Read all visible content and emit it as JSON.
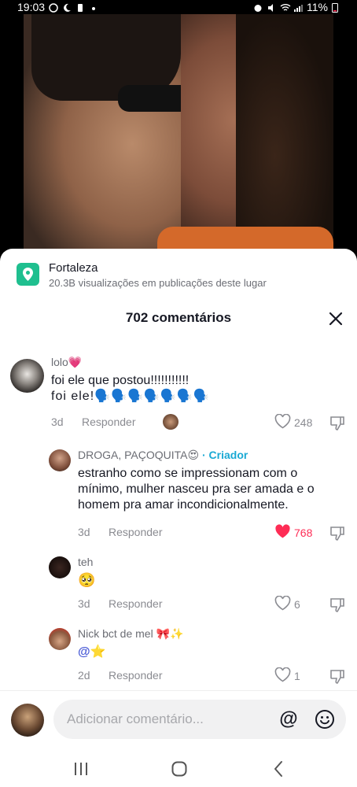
{
  "status": {
    "time": "19:03",
    "battery": "11%"
  },
  "location": {
    "title": "Fortaleza",
    "subtitle": "20.3B visualizações em publicações deste lugar"
  },
  "comments_header": "702 comentários",
  "comments": [
    {
      "username": "lolo",
      "username_emoji": "💗",
      "text_line1": "foi ele que postou!!!!!!!!!!!",
      "text_line2": "foi ele!🗣️🗣️🗣️🗣️🗣️🗣️🗣️",
      "age": "3d",
      "reply": "Responder",
      "likes": "248",
      "liked": false
    },
    {
      "username": "DROGA, PAÇOQUITA",
      "username_emoji": "😍",
      "creator_tag": "· Criador",
      "text": "estranho como se impressionam com o mínimo, mulher nasceu pra ser amada e o homem pra amar incondicionalmente.",
      "age": "3d",
      "reply": "Responder",
      "likes": "768",
      "liked": true
    },
    {
      "username": "teh",
      "text": "🥺",
      "age": "3d",
      "reply": "Responder",
      "likes": "6",
      "liked": false
    },
    {
      "username": "Nick bct de mel",
      "username_emoji": "🎀✨",
      "text": "@⭐",
      "age": "2d",
      "reply": "Responder",
      "likes": "1",
      "liked": false
    }
  ],
  "input": {
    "placeholder": "Adicionar comentário..."
  },
  "colors": {
    "accent": "#fe2c55",
    "creator": "#1aa9d4",
    "location_icon": "#1fbf8f"
  }
}
